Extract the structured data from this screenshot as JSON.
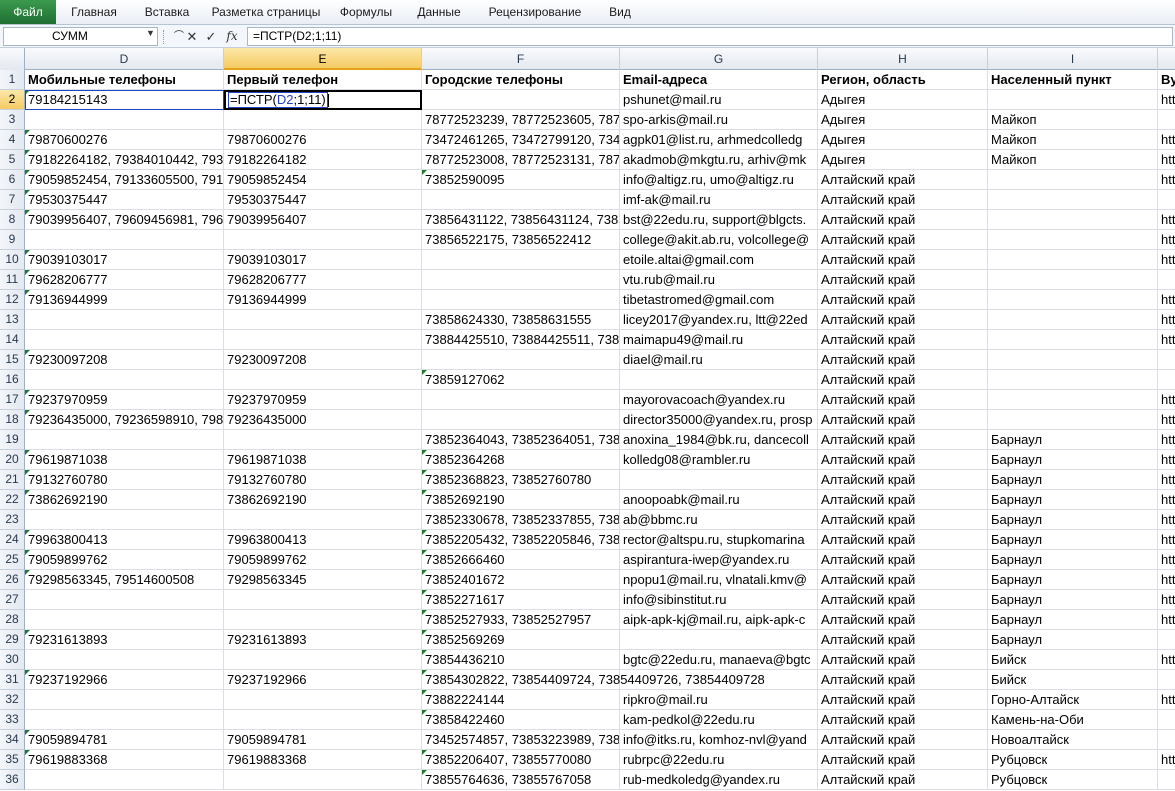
{
  "ribbon": {
    "tabs": [
      "Файл",
      "Главная",
      "Вставка",
      "Разметка страницы",
      "Формулы",
      "Данные",
      "Рецензирование",
      "Вид"
    ]
  },
  "formula_bar": {
    "name_box": "СУММ",
    "cancel_icon": "✕",
    "enter_icon": "✓",
    "fx_icon": "fx",
    "formula": "=ПСТР(D2;1;11)"
  },
  "columns": [
    {
      "letter": "D",
      "active": false
    },
    {
      "letter": "E",
      "active": true
    },
    {
      "letter": "F",
      "active": false
    },
    {
      "letter": "G",
      "active": false
    },
    {
      "letter": "H",
      "active": false
    },
    {
      "letter": "I",
      "active": false
    },
    {
      "letter": "",
      "active": false
    }
  ],
  "editing_cell": {
    "prefix": "=ПСТР(",
    "ref": "D2",
    "suffix": ";1;11)"
  },
  "rows": [
    {
      "n": "1",
      "cells": [
        "Мобильные телефоны",
        "Первый телефон",
        "Городские телефоны",
        "Email-адреса",
        "Регион, область",
        "Населенный пункт",
        "Ву"
      ]
    },
    {
      "n": "2",
      "cells": [
        "79184215143",
        "",
        "",
        "pshunet@mail.ru",
        "Адыгея",
        "",
        "htt"
      ]
    },
    {
      "n": "3",
      "cells": [
        "",
        "",
        "78772523239, 78772523605, 7877",
        "spo-arkis@mail.ru",
        "Адыгея",
        "Майкоп",
        ""
      ]
    },
    {
      "n": "4",
      "cells": [
        "79870600276",
        "79870600276",
        "73472461265, 73472799120, 7347",
        "agpk01@list.ru, arhmedcolledg",
        "Адыгея",
        "Майкоп",
        "htt"
      ]
    },
    {
      "n": "5",
      "cells": [
        "79182264182, 79384010442, 7938",
        "79182264182",
        "78772523008, 78772523131, 7877",
        "akadmob@mkgtu.ru, arhiv@mk",
        "Адыгея",
        "Майкоп",
        "htt"
      ]
    },
    {
      "n": "6",
      "cells": [
        "79059852454, 79133605500, 7913",
        "79059852454",
        "73852590095",
        "info@altigz.ru, umo@altigz.ru",
        "Алтайский край",
        "",
        "htt"
      ]
    },
    {
      "n": "7",
      "cells": [
        "79530375447",
        "79530375447",
        "",
        "imf-ak@mail.ru",
        "Алтайский край",
        "",
        ""
      ]
    },
    {
      "n": "8",
      "cells": [
        "79039956407, 79609456981, 7963",
        "79039956407",
        "73856431122, 73856431124, 7385",
        "bst@22edu.ru, support@blgcts.",
        "Алтайский край",
        "",
        "htt"
      ]
    },
    {
      "n": "9",
      "cells": [
        "",
        "",
        "73856522175, 73856522412",
        "college@akit.ab.ru, volcollege@",
        "Алтайский край",
        "",
        "htt"
      ]
    },
    {
      "n": "10",
      "cells": [
        "79039103017",
        "79039103017",
        "",
        "etoile.altai@gmail.com",
        "Алтайский край",
        "",
        "htt"
      ]
    },
    {
      "n": "11",
      "cells": [
        "79628206777",
        "79628206777",
        "",
        "vtu.rub@mail.ru",
        "Алтайский край",
        "",
        ""
      ]
    },
    {
      "n": "12",
      "cells": [
        "79136944999",
        "79136944999",
        "",
        "tibetastromed@gmail.com",
        "Алтайский край",
        "",
        "htt"
      ]
    },
    {
      "n": "13",
      "cells": [
        "",
        "",
        "73858624330, 73858631555",
        "licey2017@yandex.ru, ltt@22ed",
        "Алтайский край",
        "",
        "htt"
      ]
    },
    {
      "n": "14",
      "cells": [
        "",
        "",
        "73884425510, 73884425511, 7388",
        "maimapu49@mail.ru",
        "Алтайский край",
        "",
        "htt"
      ]
    },
    {
      "n": "15",
      "cells": [
        "79230097208",
        "79230097208",
        "",
        "diael@mail.ru",
        "Алтайский край",
        "",
        ""
      ]
    },
    {
      "n": "16",
      "cells": [
        "",
        "",
        "73859127062",
        "",
        "Алтайский край",
        "",
        ""
      ]
    },
    {
      "n": "17",
      "cells": [
        "79237970959",
        "79237970959",
        "",
        "mayorovacoach@yandex.ru",
        "Алтайский край",
        "",
        "htt"
      ]
    },
    {
      "n": "18",
      "cells": [
        "79236435000, 79236598910, 7985",
        "79236435000",
        "",
        "director35000@yandex.ru, prosp",
        "Алтайский край",
        "",
        "htt"
      ]
    },
    {
      "n": "19",
      "cells": [
        "",
        "",
        "73852364043, 73852364051, 7385",
        "anoxina_1984@bk.ru, dancecoll",
        "Алтайский край",
        "Барнаул",
        "htt"
      ]
    },
    {
      "n": "20",
      "cells": [
        "79619871038",
        "79619871038",
        "73852364268",
        "kolledg08@rambler.ru",
        "Алтайский край",
        "Барнаул",
        "htt"
      ]
    },
    {
      "n": "21",
      "cells": [
        "79132760780",
        "79132760780",
        "73852368823, 73852760780",
        "",
        "Алтайский край",
        "Барнаул",
        "htt"
      ]
    },
    {
      "n": "22",
      "cells": [
        "73862692190",
        "73862692190",
        "73852692190",
        "anoopoabk@mail.ru",
        "Алтайский край",
        "Барнаул",
        "htt"
      ]
    },
    {
      "n": "23",
      "cells": [
        "",
        "",
        "73852330678, 73852337855, 7385",
        "ab@bbmc.ru",
        "Алтайский край",
        "Барнаул",
        "htt"
      ]
    },
    {
      "n": "24",
      "cells": [
        "79963800413",
        "79963800413",
        "73852205432, 73852205846, 7385",
        "rector@altspu.ru, stupkomarina",
        "Алтайский край",
        "Барнаул",
        "htt"
      ]
    },
    {
      "n": "25",
      "cells": [
        "79059899762",
        "79059899762",
        "73852666460",
        "aspirantura-iwep@yandex.ru",
        "Алтайский край",
        "Барнаул",
        "htt"
      ]
    },
    {
      "n": "26",
      "cells": [
        "79298563345, 79514600508",
        "79298563345",
        "73852401672",
        "npopu1@mail.ru, vlnatali.kmv@",
        "Алтайский край",
        "Барнаул",
        "htt"
      ]
    },
    {
      "n": "27",
      "cells": [
        "",
        "",
        "73852271617",
        "info@sibinstitut.ru",
        "Алтайский край",
        "Барнаул",
        "htt"
      ]
    },
    {
      "n": "28",
      "cells": [
        "",
        "",
        "73852527933, 73852527957",
        "aipk-apk-kj@mail.ru, aipk-apk-c",
        "Алтайский край",
        "Барнаул",
        "htt"
      ]
    },
    {
      "n": "29",
      "cells": [
        "79231613893",
        "79231613893",
        "73852569269",
        "",
        "Алтайский край",
        "Барнаул",
        ""
      ]
    },
    {
      "n": "30",
      "cells": [
        "",
        "",
        "73854436210",
        "bgtc@22edu.ru, manaeva@bgtc",
        "Алтайский край",
        "Бийск",
        "htt"
      ]
    },
    {
      "n": "31",
      "cells": [
        "79237192966",
        "79237192966",
        "73854302822, 73854409724, 73854409726, 73854409728",
        "",
        "Алтайский край",
        "Бийск",
        ""
      ]
    },
    {
      "n": "32",
      "cells": [
        "",
        "",
        "73882224144",
        "ripkro@mail.ru",
        "Алтайский край",
        "Горно-Алтайск",
        "htt"
      ]
    },
    {
      "n": "33",
      "cells": [
        "",
        "",
        "73858422460",
        "kam-pedkol@22edu.ru",
        "Алтайский край",
        "Камень-на-Оби",
        ""
      ]
    },
    {
      "n": "34",
      "cells": [
        "79059894781",
        "79059894781",
        "73452574857, 73853223989, 7385",
        "info@itks.ru, komhoz-nvl@yand",
        "Алтайский край",
        "Новоалтайск",
        ""
      ]
    },
    {
      "n": "35",
      "cells": [
        "79619883368",
        "79619883368",
        "73852206407, 73855770080",
        "rubrpc@22edu.ru",
        "Алтайский край",
        "Рубцовск",
        "htt"
      ]
    },
    {
      "n": "36",
      "cells": [
        "",
        "",
        "73855764636, 73855767058",
        "rub-medkoledg@yandex.ru",
        "Алтайский край",
        "Рубцовск",
        ""
      ]
    }
  ],
  "green_triangle_rows": {
    "D": [
      "2",
      "4",
      "5",
      "6",
      "7",
      "8",
      "10",
      "11",
      "12",
      "15",
      "17",
      "18",
      "20",
      "21",
      "22",
      "24",
      "25",
      "26",
      "29",
      "31",
      "34",
      "35"
    ],
    "F": [
      "6",
      "16",
      "20",
      "21",
      "22",
      "24",
      "25",
      "26",
      "27",
      "28",
      "29",
      "30",
      "31",
      "32",
      "33",
      "35",
      "36"
    ]
  }
}
